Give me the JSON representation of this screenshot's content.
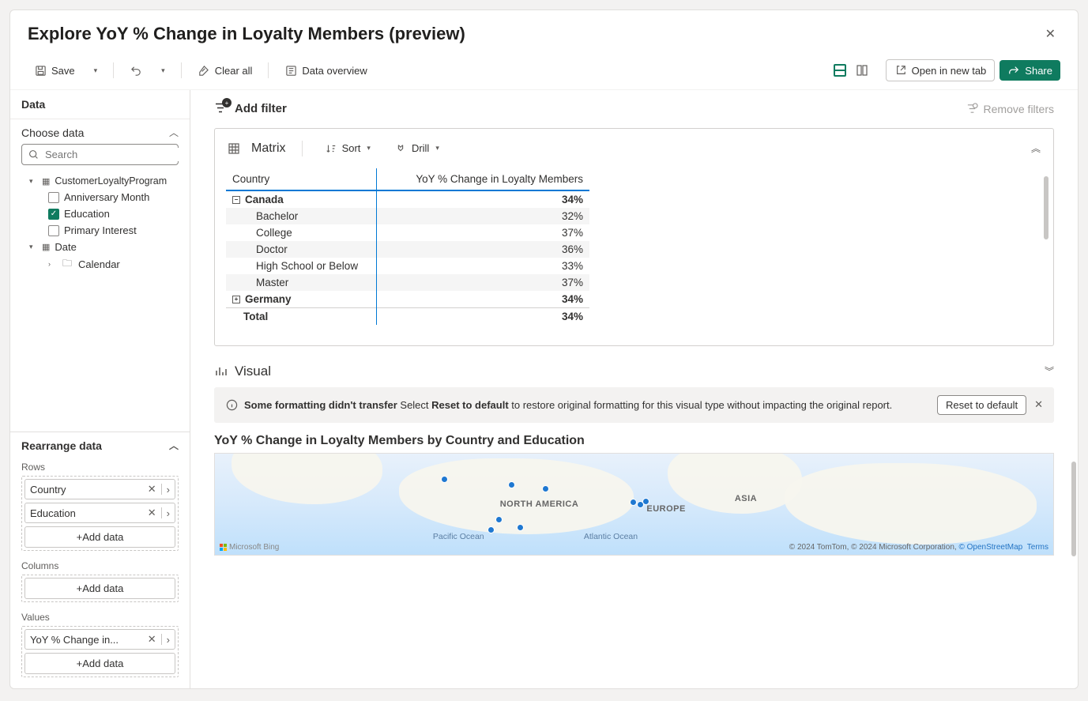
{
  "title": "Explore YoY % Change in Loyalty Members (preview)",
  "toolbar": {
    "save": "Save",
    "clear_all": "Clear all",
    "data_overview": "Data overview",
    "open_new_tab": "Open in new tab",
    "share": "Share"
  },
  "data_panel": {
    "header": "Data",
    "choose_data": "Choose data",
    "search_placeholder": "Search",
    "tables": {
      "customer_loyalty": {
        "name": "CustomerLoyaltyProgram",
        "fields": {
          "anniversary_month": "Anniversary Month",
          "education": "Education",
          "primary_interest": "Primary Interest"
        }
      },
      "date": {
        "name": "Date",
        "calendar": "Calendar"
      }
    }
  },
  "rearrange": {
    "header": "Rearrange data",
    "rows_lbl": "Rows",
    "columns_lbl": "Columns",
    "values_lbl": "Values",
    "add_data": "+Add data",
    "rows": {
      "0": "Country",
      "1": "Education"
    },
    "values": {
      "0": "YoY % Change in..."
    }
  },
  "filters": {
    "add_filter": "Add filter",
    "remove_filters": "Remove filters"
  },
  "matrix": {
    "title": "Matrix",
    "sort": "Sort",
    "drill": "Drill",
    "col_country": "Country",
    "col_measure": "YoY % Change in Loyalty Members",
    "rows": {
      "canada": {
        "label": "Canada",
        "value": "34%"
      },
      "bachelor": {
        "label": "Bachelor",
        "value": "32%"
      },
      "college": {
        "label": "College",
        "value": "37%"
      },
      "doctor": {
        "label": "Doctor",
        "value": "36%"
      },
      "hs": {
        "label": "High School or Below",
        "value": "33%"
      },
      "master": {
        "label": "Master",
        "value": "37%"
      },
      "germany": {
        "label": "Germany",
        "value": "34%"
      },
      "total": {
        "label": "Total",
        "value": "34%"
      }
    }
  },
  "visual": {
    "header": "Visual",
    "banner_bold": "Some formatting didn't transfer",
    "banner_mid1": " Select ",
    "banner_bold2": "Reset to default",
    "banner_mid2": " to restore original formatting for this visual type without impacting the original report.",
    "reset_btn": "Reset to default",
    "chart_title": "YoY % Change in Loyalty Members by Country and Education",
    "map": {
      "na": "NORTH AMERICA",
      "eu": "EUROPE",
      "asia": "ASIA",
      "pacific": "Pacific Ocean",
      "atlantic": "Atlantic Ocean",
      "bing": "Microsoft Bing",
      "attr1": "© 2024 TomTom, © 2024 Microsoft Corporation, ",
      "attr2": "© OpenStreetMap",
      "attr3": "Terms"
    }
  }
}
